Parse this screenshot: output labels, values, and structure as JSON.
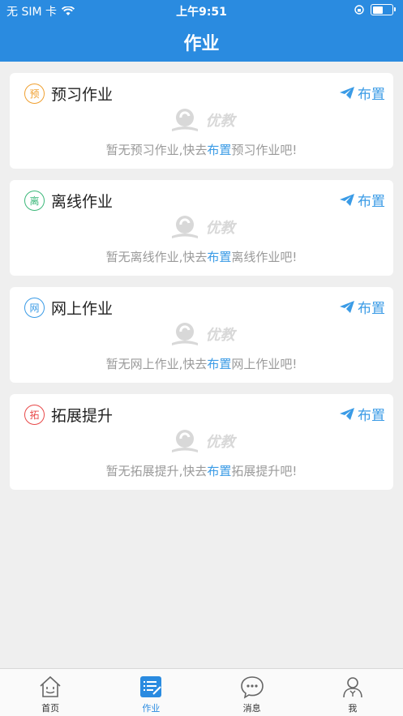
{
  "status_bar": {
    "carrier": "无 SIM 卡",
    "time": "上午9:51",
    "battery_level": 0.55
  },
  "header": {
    "title": "作业"
  },
  "colors": {
    "primary": "#2a8be0",
    "link": "#3a9be6"
  },
  "cards": [
    {
      "badge": "预",
      "badge_color": "#f0a030",
      "title": "预习作业",
      "action": "布置",
      "wm": "优教",
      "msg_pre": "暂无预习作业,快去",
      "msg_link": "布置",
      "msg_post": "预习作业吧!"
    },
    {
      "badge": "离",
      "badge_color": "#3cb87a",
      "title": "离线作业",
      "action": "布置",
      "wm": "优教",
      "msg_pre": "暂无离线作业,快去",
      "msg_link": "布置",
      "msg_post": "离线作业吧!"
    },
    {
      "badge": "网",
      "badge_color": "#3a9be6",
      "title": "网上作业",
      "action": "布置",
      "wm": "优教",
      "msg_pre": "暂无网上作业,快去",
      "msg_link": "布置",
      "msg_post": "网上作业吧!"
    },
    {
      "badge": "拓",
      "badge_color": "#e84848",
      "title": "拓展提升",
      "action": "布置",
      "wm": "优教",
      "msg_pre": "暂无拓展提升,快去",
      "msg_link": "布置",
      "msg_post": "拓展提升吧!"
    }
  ],
  "tabbar": [
    {
      "label": "首页",
      "icon": "home-icon"
    },
    {
      "label": "作业",
      "icon": "homework-icon",
      "active": true
    },
    {
      "label": "消息",
      "icon": "message-icon"
    },
    {
      "label": "我",
      "icon": "profile-icon"
    }
  ]
}
